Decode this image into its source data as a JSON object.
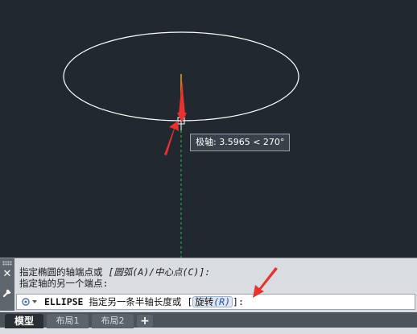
{
  "tooltip": {
    "label": "极轴: 3.5965 < 270°"
  },
  "command_line": {
    "history": [
      {
        "text": "指定椭圆的轴端点或 ",
        "options": "[圆弧(A)/中心点(C)]:"
      },
      {
        "text": "指定轴的另一个端点:",
        "options": ""
      }
    ],
    "prompt": {
      "command": "ELLIPSE",
      "text": " 指定另一条半轴长度或 [",
      "option_label": "旋转",
      "option_key": "(R)",
      "suffix": "]:"
    }
  },
  "tabs": [
    {
      "label": "模型",
      "active": true
    },
    {
      "label": "布局1",
      "active": false
    },
    {
      "label": "布局2",
      "active": false
    }
  ],
  "add_tab_label": "+",
  "colors": {
    "canvas_bg": "#212830",
    "ellipse": "#ffffff",
    "polar_track": "#2fb84a",
    "annotation_arrow": "#e8322e",
    "command_bg": "#d9dde2"
  },
  "icons": {
    "close": "close-icon",
    "customize": "wrench-icon",
    "prompt": "command-prompt-icon",
    "crosshair": "crosshair-cursor-icon"
  }
}
